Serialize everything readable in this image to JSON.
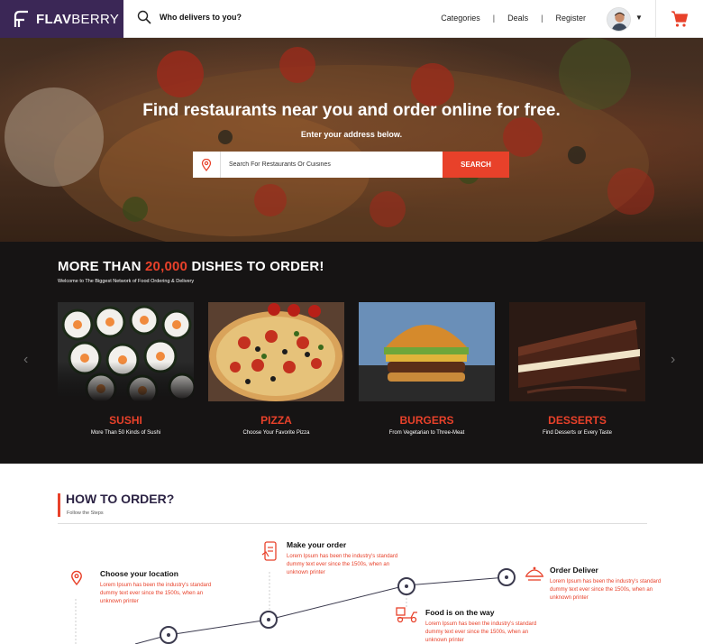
{
  "brand": {
    "name_bold": "FLAV",
    "name_light": "BERRY"
  },
  "header": {
    "search_prompt": "Who delivers to you?",
    "nav": [
      {
        "label": "Categories"
      },
      {
        "label": "Deals"
      },
      {
        "label": "Register"
      }
    ],
    "separator": "|",
    "caret": "▼"
  },
  "hero": {
    "title": "Find restaurants near you and order online for free.",
    "subtitle": "Enter your address below.",
    "search": {
      "placeholder": "Search For Restaurants Or Cuisines",
      "value": "",
      "button": "SEARCH"
    }
  },
  "dishes": {
    "heading_pre": "MORE THAN ",
    "heading_count": "20,000",
    "heading_post": " DISHES TO ORDER!",
    "tagline": "Welcome to The Biggest Network of Food Ordering & Delivery",
    "prev_arrow": "‹",
    "next_arrow": "›",
    "cards": [
      {
        "title": "SUSHI",
        "subtitle": "More Than 50 Kinds of Sushi"
      },
      {
        "title": "PIZZA",
        "subtitle": "Choose Your Favorite Pizza"
      },
      {
        "title": "BURGERS",
        "subtitle": "From Vegetarian to Three-Meat"
      },
      {
        "title": "DESSERTS",
        "subtitle": "Find Desserts or Every Taste"
      }
    ]
  },
  "howto": {
    "title": "HOW TO ORDER?",
    "follow": "Follow the Steps",
    "steps": [
      {
        "title": "Choose your location",
        "text": "Lorem Ipsum has been the industry's standard dummy text ever since the 1500s, when an unknown printer"
      },
      {
        "title": "Make your order",
        "text": "Lorem Ipsum has been the industry's standard dummy text ever since the 1500s, when an unknown printer"
      },
      {
        "title": "Food is on the way",
        "text": "Lorem Ipsum has been the industry's standard dummy text ever since the 1500s, when an unknown printer"
      },
      {
        "title": "Order Deliver",
        "text": "Lorem Ipsum has been the industry's standard dummy text ever since the 1500s, when an unknown printer"
      }
    ]
  },
  "colors": {
    "brand": "#3b2756",
    "accent": "#e8412a",
    "dark_band": "#161414"
  }
}
